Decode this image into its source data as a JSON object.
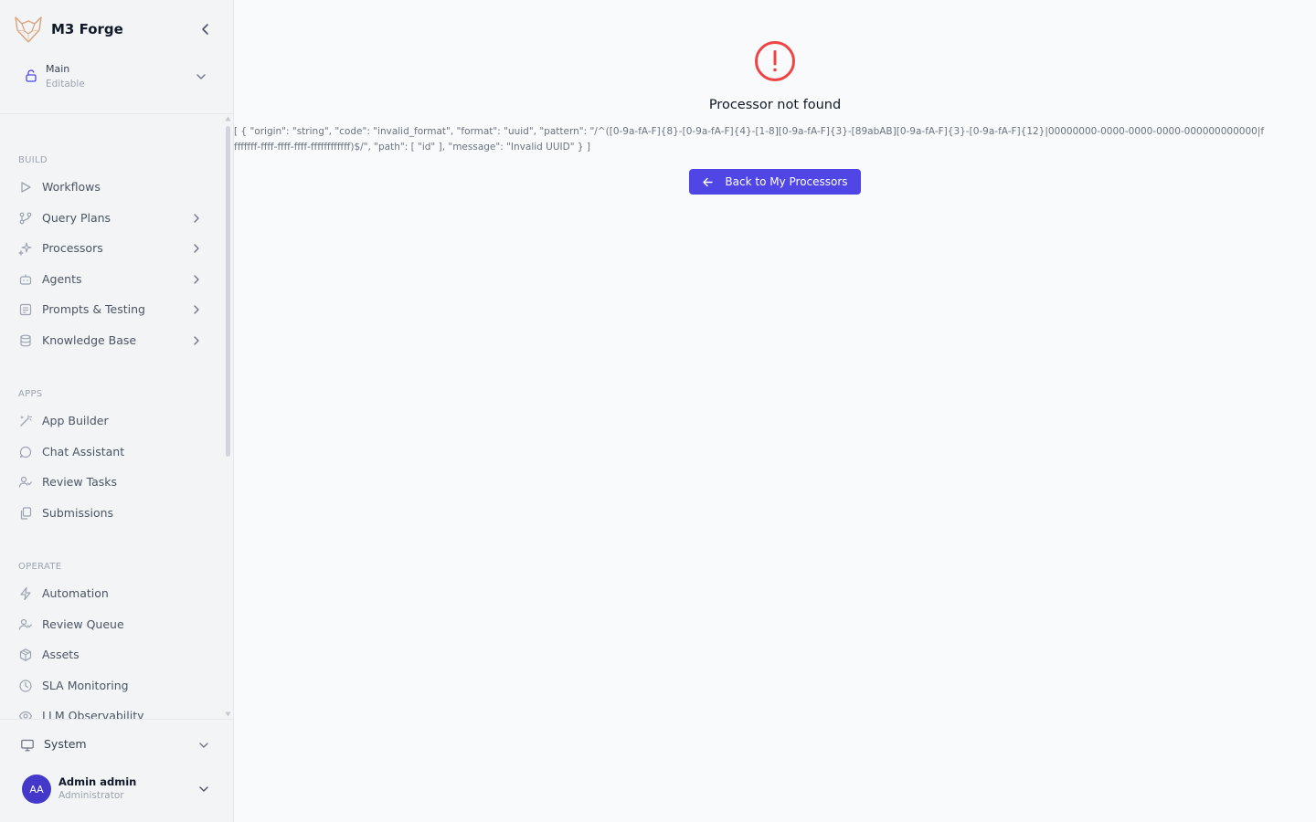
{
  "app": {
    "name": "M3 Forge",
    "colors": {
      "accent": "#4f46e5",
      "error": "#ef4444",
      "sidebar_bg": "#f3f4f6"
    }
  },
  "branch": {
    "title": "Main",
    "subtitle": "Editable"
  },
  "sections": {
    "build": "BUILD",
    "apps": "APPS",
    "operate": "OPERATE"
  },
  "nav": {
    "workflows": "Workflows",
    "query_plans": "Query Plans",
    "processors": "Processors",
    "agents": "Agents",
    "prompts_testing": "Prompts & Testing",
    "knowledge_base": "Knowledge Base",
    "app_builder": "App Builder",
    "chat_assistant": "Chat Assistant",
    "review_tasks": "Review Tasks",
    "submissions": "Submissions",
    "automation": "Automation",
    "review_queue": "Review Queue",
    "assets": "Assets",
    "sla_monitoring": "SLA Monitoring",
    "llm_observability": "LLM Observability"
  },
  "system": {
    "label": "System"
  },
  "user": {
    "initials": "AA",
    "name": "Admin admin",
    "role": "Administrator"
  },
  "error": {
    "title": "Processor not found",
    "detail": "[ { \"origin\": \"string\", \"code\": \"invalid_format\", \"format\": \"uuid\", \"pattern\": \"/^([0-9a-fA-F]{8}-[0-9a-fA-F]{4}-[1-8][0-9a-fA-F]{3}-[89abAB][0-9a-fA-F]{3}-[0-9a-fA-F]{12}|00000000-0000-0000-0000-000000000000|ffffffff-ffff-ffff-ffff-ffffffffffff)$/\", \"path\": [ \"id\" ], \"message\": \"Invalid UUID\" } ]",
    "back_label": "Back to My Processors"
  }
}
